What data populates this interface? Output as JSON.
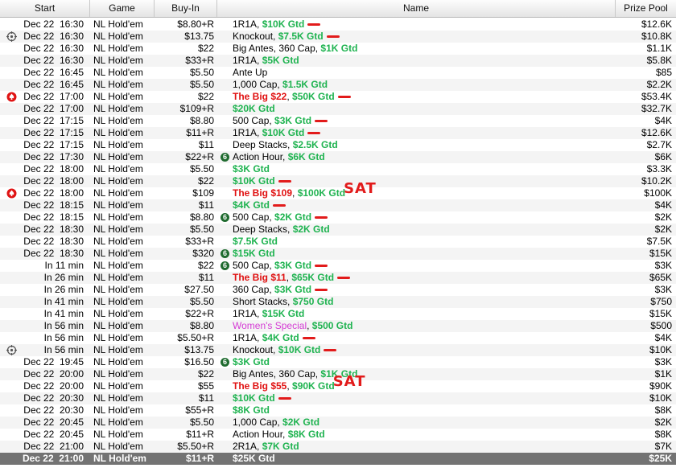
{
  "columns": {
    "start": "Start",
    "game": "Game",
    "buyin": "Buy-In",
    "name": "Name",
    "prize": "Prize Pool"
  },
  "colors": {
    "gtd": "#1fb350",
    "big": "#e01010",
    "womens": "#d43bd4",
    "selected_bg": "#737373"
  },
  "annotations": {
    "sat": "SAT"
  },
  "rows": [
    {
      "start": "Dec 22  16:30",
      "game": "NL Hold'em",
      "buyin": "$8.80+R",
      "pre": "1R1A, ",
      "gtd": "$10K Gtd",
      "pool": "$12.6K",
      "dash": 1
    },
    {
      "start": "Dec 22  16:30",
      "game": "NL Hold'em",
      "buyin": "$13.75",
      "pre": "Knockout, ",
      "gtd": "$7.5K Gtd",
      "pool": "$10.8K",
      "dash": 1,
      "icon": "crosshair-icon"
    },
    {
      "start": "Dec 22  16:30",
      "game": "NL Hold'em",
      "buyin": "$22",
      "pre": "Big Antes, 360 Cap, ",
      "gtd": "$1K Gtd",
      "pool": "$1.1K"
    },
    {
      "start": "Dec 22  16:30",
      "game": "NL Hold'em",
      "buyin": "$33+R",
      "pre": "1R1A, ",
      "gtd": "$5K Gtd",
      "pool": "$5.8K"
    },
    {
      "start": "Dec 22  16:45",
      "game": "NL Hold'em",
      "buyin": "$5.50",
      "pre": "Ante Up",
      "gtd": "",
      "pool": "$85"
    },
    {
      "start": "Dec 22  16:45",
      "game": "NL Hold'em",
      "buyin": "$5.50",
      "pre": "1,000 Cap, ",
      "gtd": "$1.5K Gtd",
      "pool": "$2.2K"
    },
    {
      "start": "Dec 22  17:00",
      "game": "NL Hold'em",
      "buyin": "$22",
      "big": "The Big $22",
      "gtd": "$50K Gtd",
      "pool": "$53.4K",
      "dash": 1,
      "icon": "pokerstars-spade-icon"
    },
    {
      "start": "Dec 22  17:00",
      "game": "NL Hold'em",
      "buyin": "$109+R",
      "pre": "",
      "gtd": "$20K Gtd",
      "pool": "$32.7K"
    },
    {
      "start": "Dec 22  17:15",
      "game": "NL Hold'em",
      "buyin": "$8.80",
      "pre": "500 Cap, ",
      "gtd": "$3K Gtd",
      "pool": "$4K",
      "dash": 1
    },
    {
      "start": "Dec 22  17:15",
      "game": "NL Hold'em",
      "buyin": "$11+R",
      "pre": "1R1A, ",
      "gtd": "$10K Gtd",
      "pool": "$12.6K",
      "dash": 1
    },
    {
      "start": "Dec 22  17:15",
      "game": "NL Hold'em",
      "buyin": "$11",
      "pre": "Deep Stacks, ",
      "gtd": "$2.5K Gtd",
      "pool": "$2.7K"
    },
    {
      "start": "Dec 22  17:30",
      "game": "NL Hold'em",
      "buyin": "$22+R",
      "pre": "Action Hour, ",
      "gtd": "$6K Gtd",
      "pool": "$6K",
      "six": "6"
    },
    {
      "start": "Dec 22  18:00",
      "game": "NL Hold'em",
      "buyin": "$5.50",
      "pre": "",
      "gtd": "$3K Gtd",
      "pool": "$3.3K"
    },
    {
      "start": "Dec 22  18:00",
      "game": "NL Hold'em",
      "buyin": "$22",
      "pre": "",
      "gtd": "$10K Gtd",
      "pool": "$10.2K",
      "dash": 1
    },
    {
      "start": "Dec 22  18:00",
      "game": "NL Hold'em",
      "buyin": "$109",
      "big": "The Big $109",
      "gtd": "$100K Gtd",
      "pool": "$100K",
      "sat": 1,
      "icon": "pokerstars-spade-icon"
    },
    {
      "start": "Dec 22  18:15",
      "game": "NL Hold'em",
      "buyin": "$11",
      "pre": "",
      "gtd": "$4K Gtd",
      "pool": "$4K",
      "dash": 1
    },
    {
      "start": "Dec 22  18:15",
      "game": "NL Hold'em",
      "buyin": "$8.80",
      "pre": "500 Cap, ",
      "gtd": "$2K Gtd",
      "pool": "$2K",
      "dash": 1,
      "six": "6"
    },
    {
      "start": "Dec 22  18:30",
      "game": "NL Hold'em",
      "buyin": "$5.50",
      "pre": "Deep Stacks, ",
      "gtd": "$2K Gtd",
      "pool": "$2K"
    },
    {
      "start": "Dec 22  18:30",
      "game": "NL Hold'em",
      "buyin": "$33+R",
      "pre": "",
      "gtd": "$7.5K Gtd",
      "pool": "$7.5K"
    },
    {
      "start": "Dec 22  18:30",
      "game": "NL Hold'em",
      "buyin": "$320",
      "pre": "",
      "gtd": "$15K Gtd",
      "pool": "$15K",
      "six": "6"
    },
    {
      "start": "In 11 min",
      "game": "NL Hold'em",
      "buyin": "$22",
      "pre": "500 Cap, ",
      "gtd": "$3K Gtd",
      "pool": "$3K",
      "dash": 1,
      "six": "6"
    },
    {
      "start": "In 26 min",
      "game": "NL Hold'em",
      "buyin": "$11",
      "big": "The Big $11",
      "gtd": "$65K Gtd",
      "pool": "$65K",
      "dash": 1
    },
    {
      "start": "In 26 min",
      "game": "NL Hold'em",
      "buyin": "$27.50",
      "pre": "360 Cap, ",
      "gtd": "$3K Gtd",
      "pool": "$3K",
      "dash": 1
    },
    {
      "start": "In 41 min",
      "game": "NL Hold'em",
      "buyin": "$5.50",
      "pre": "Short Stacks, ",
      "gtd": "$750 Gtd",
      "pool": "$750"
    },
    {
      "start": "In 41 min",
      "game": "NL Hold'em",
      "buyin": "$22+R",
      "pre": "1R1A, ",
      "gtd": "$15K Gtd",
      "pool": "$15K"
    },
    {
      "start": "In 56 min",
      "game": "NL Hold'em",
      "buyin": "$8.80",
      "womens": "Women's Special",
      "gtd": "$500 Gtd",
      "pool": "$500"
    },
    {
      "start": "In 56 min",
      "game": "NL Hold'em",
      "buyin": "$5.50+R",
      "pre": "1R1A, ",
      "gtd": "$4K Gtd",
      "pool": "$4K",
      "dash": 1
    },
    {
      "start": "In 56 min",
      "game": "NL Hold'em",
      "buyin": "$13.75",
      "pre": "Knockout, ",
      "gtd": "$10K Gtd",
      "pool": "$10K",
      "dash": 1,
      "icon": "crosshair-icon"
    },
    {
      "start": "Dec 22  19:45",
      "game": "NL Hold'em",
      "buyin": "$16.50",
      "pre": "",
      "gtd": "$3K Gtd",
      "pool": "$3K",
      "six": "6"
    },
    {
      "start": "Dec 22  20:00",
      "game": "NL Hold'em",
      "buyin": "$22",
      "pre": "Big Antes, 360 Cap, ",
      "gtd": "$1K Gtd",
      "pool": "$1K"
    },
    {
      "start": "Dec 22  20:00",
      "game": "NL Hold'em",
      "buyin": "$55",
      "big": "The Big $55",
      "gtd": "$90K Gtd",
      "pool": "$90K",
      "sat": 1
    },
    {
      "start": "Dec 22  20:30",
      "game": "NL Hold'em",
      "buyin": "$11",
      "pre": "",
      "gtd": "$10K Gtd",
      "pool": "$10K",
      "dash": 1
    },
    {
      "start": "Dec 22  20:30",
      "game": "NL Hold'em",
      "buyin": "$55+R",
      "pre": "",
      "gtd": "$8K Gtd",
      "pool": "$8K"
    },
    {
      "start": "Dec 22  20:45",
      "game": "NL Hold'em",
      "buyin": "$5.50",
      "pre": "1,000 Cap, ",
      "gtd": "$2K Gtd",
      "pool": "$2K"
    },
    {
      "start": "Dec 22  20:45",
      "game": "NL Hold'em",
      "buyin": "$11+R",
      "pre": "Action Hour, ",
      "gtd": "$8K Gtd",
      "pool": "$8K"
    },
    {
      "start": "Dec 22  21:00",
      "game": "NL Hold'em",
      "buyin": "$5.50+R",
      "pre": "2R1A, ",
      "gtd": "$7K Gtd",
      "pool": "$7K"
    },
    {
      "start": "Dec 22  21:00",
      "game": "NL Hold'em",
      "buyin": "$11+R",
      "pre": "",
      "gtd": "$25K Gtd",
      "pool": "$25K",
      "selected": 1
    }
  ]
}
